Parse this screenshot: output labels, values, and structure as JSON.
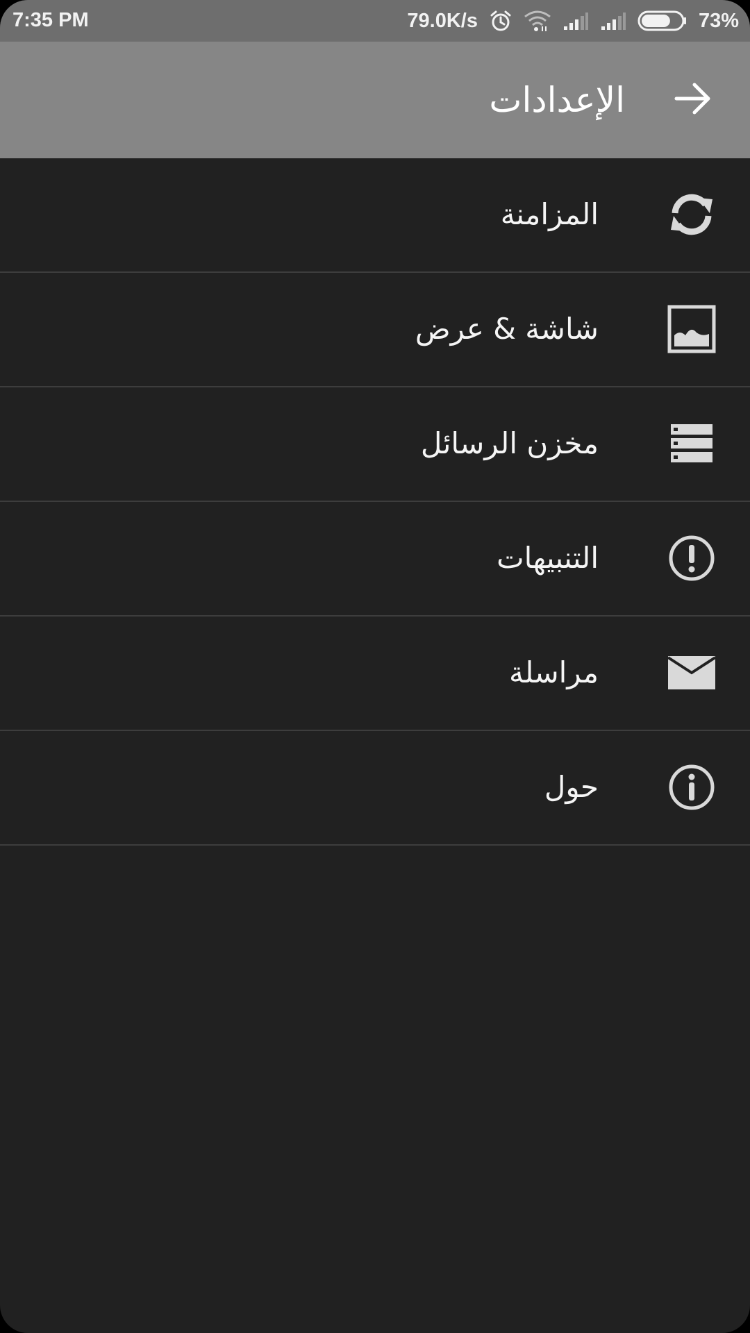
{
  "status_bar": {
    "time": "7:35 PM",
    "network_speed": "79.0K/s",
    "battery_percent": "73%",
    "battery_level": 0.73,
    "icons": [
      "alarm-icon",
      "wifi-icon",
      "signal-icon",
      "signal-icon",
      "battery-icon"
    ]
  },
  "app_bar": {
    "title": "الإعدادات",
    "back_icon": "arrow-right-icon",
    "background_color": "#868686"
  },
  "settings": {
    "items": [
      {
        "label": "المزامنة",
        "icon": "sync-icon"
      },
      {
        "label": "شاشة & عرض",
        "icon": "image-icon"
      },
      {
        "label": "مخزن الرسائل",
        "icon": "storage-icon"
      },
      {
        "label": "التنبيهات",
        "icon": "alert-icon"
      },
      {
        "label": "مراسلة",
        "icon": "mail-icon"
      },
      {
        "label": "حول",
        "icon": "info-icon"
      }
    ]
  },
  "colors": {
    "background": "#212121",
    "status_bar": "#6e6e6e",
    "divider": "#3d3d3d",
    "icon": "#d9d9d9"
  }
}
